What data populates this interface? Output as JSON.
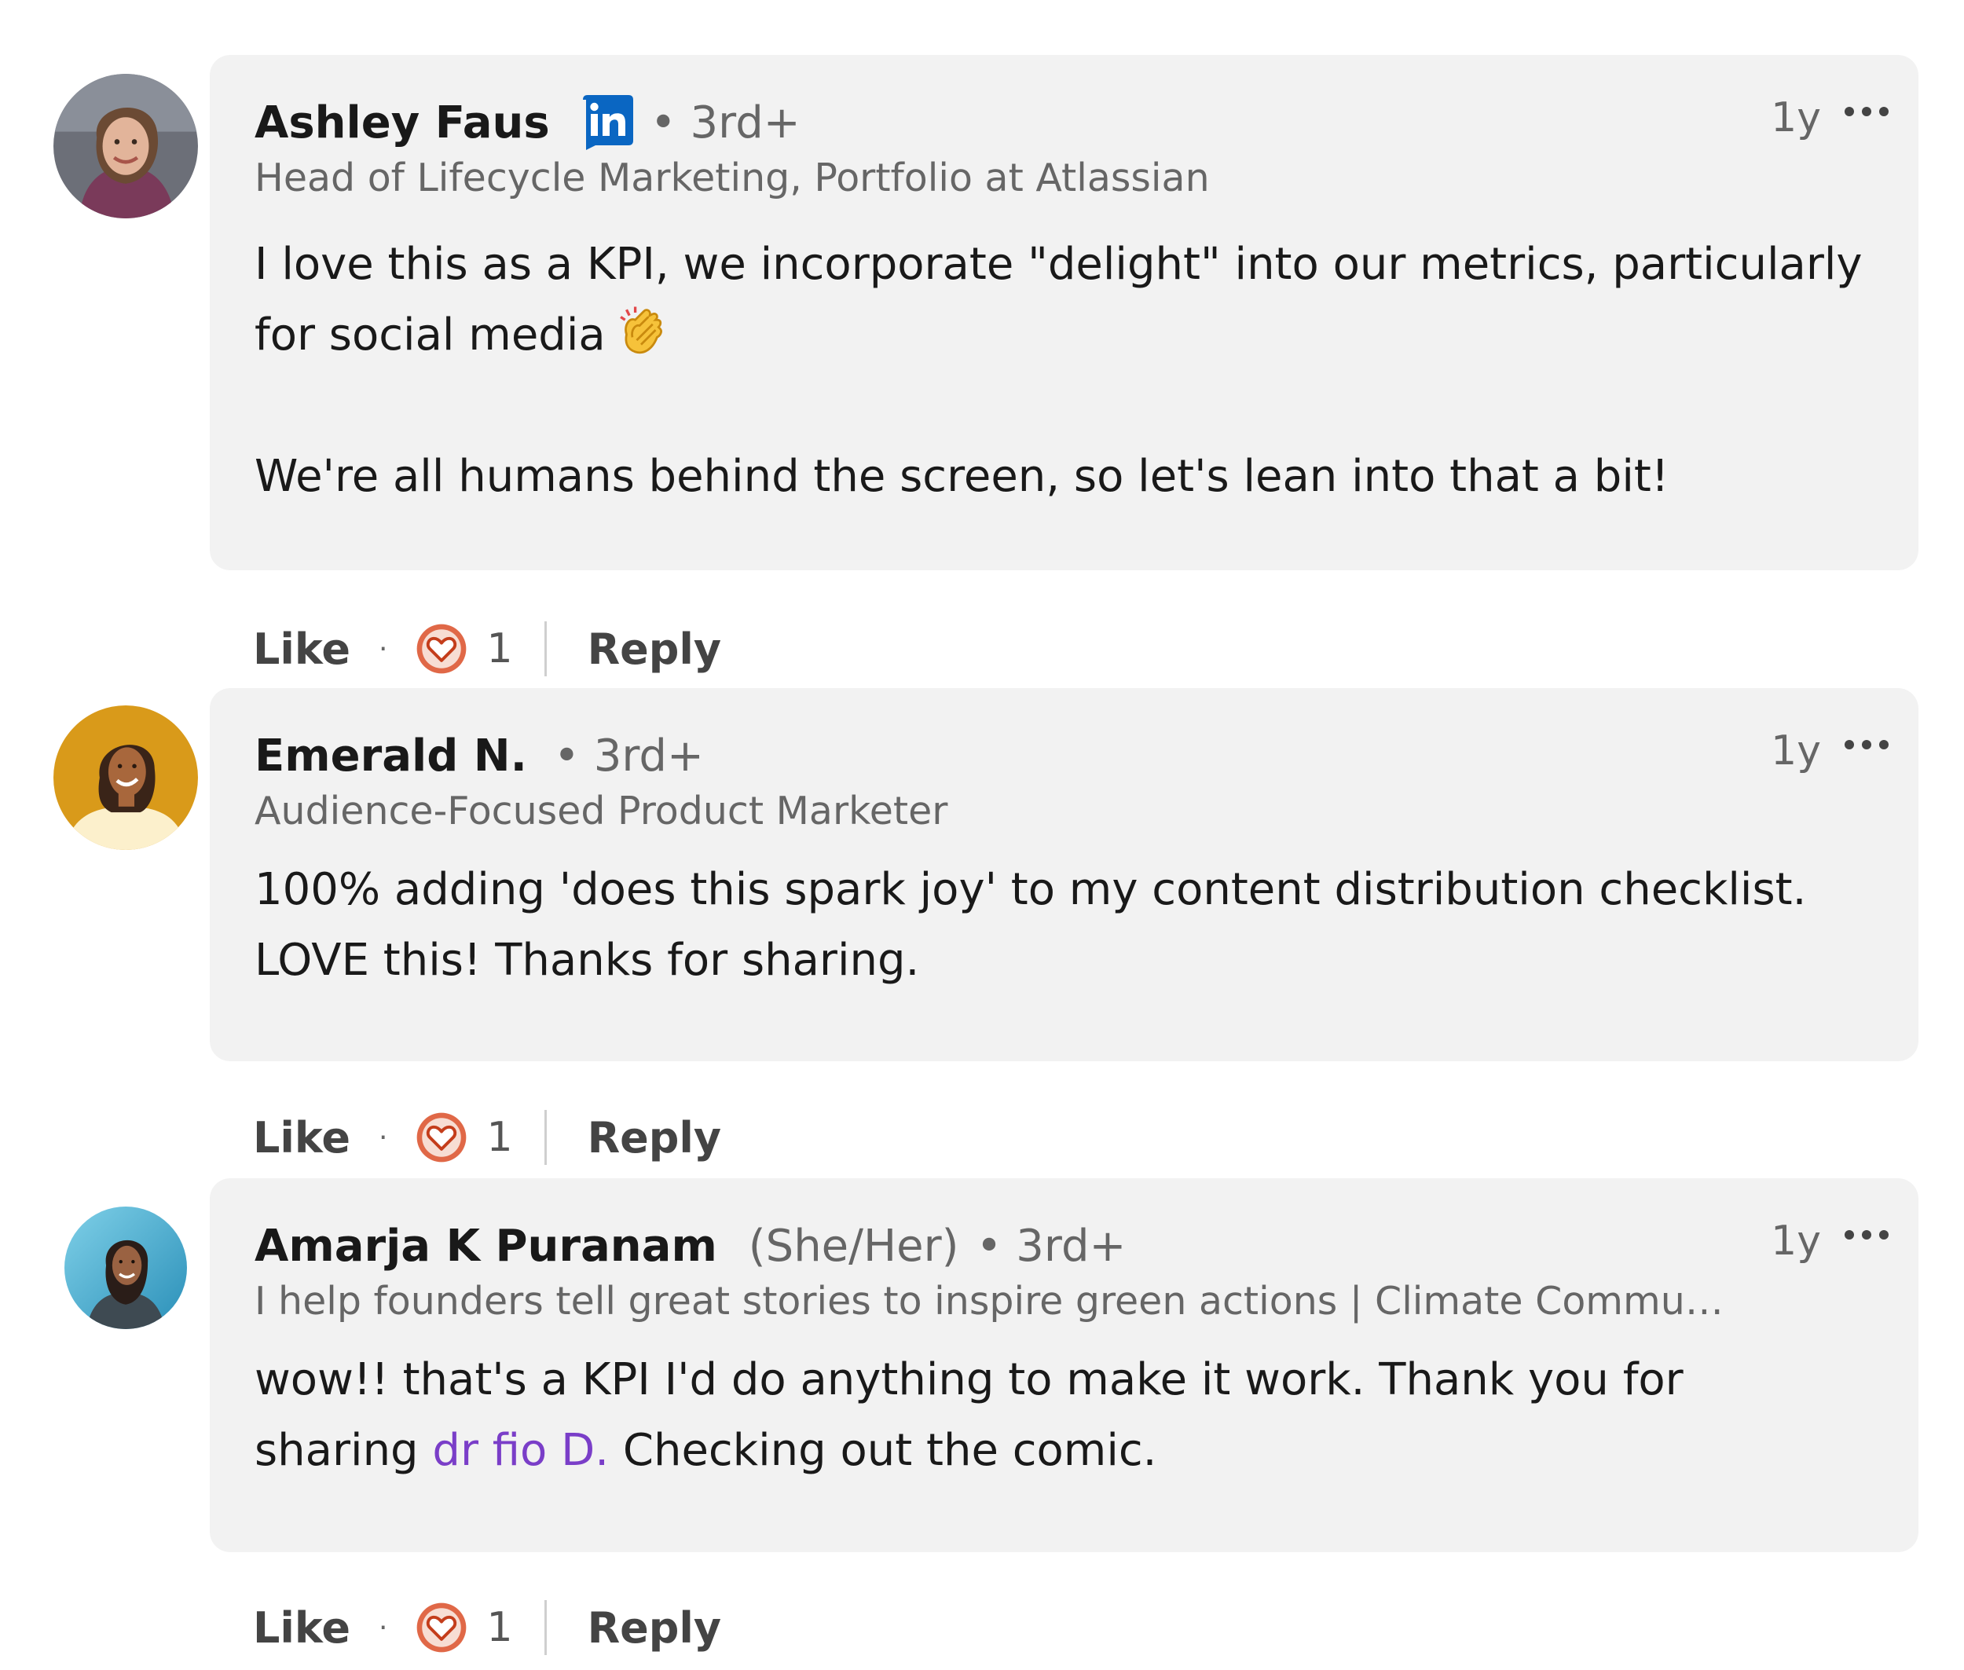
{
  "comments": [
    {
      "author": "Ashley Faus",
      "pronouns": "",
      "badge": "in",
      "degree": "• 3rd+",
      "time": "1y",
      "headline": "Head of Lifecycle Marketing, Portfolio at Atlassian",
      "body": [
        "I love this as a KPI, we incorporate \"delight\" into our metrics, particularly for social media",
        "We're all humans behind the screen, so let's lean into that a bit!"
      ],
      "emoji": "clapping-hands",
      "actions": {
        "like": "Like",
        "dot": "·",
        "count": "1",
        "reply": "Reply"
      }
    },
    {
      "author": "Emerald N.",
      "pronouns": "",
      "degree": "• 3rd+",
      "time": "1y",
      "headline": "Audience-Focused Product Marketer",
      "body": [
        "100% adding 'does this spark joy' to my content distribution checklist.",
        "LOVE this! Thanks for sharing."
      ],
      "actions": {
        "like": "Like",
        "dot": "·",
        "count": "1",
        "reply": "Reply"
      }
    },
    {
      "author": "Amarja K Puranam",
      "pronouns": "(She/Her)",
      "degree": "• 3rd+",
      "time": "1y",
      "headline": "I help founders tell great stories to inspire green actions | Climate Commu…",
      "body_line1": "wow!! that's a KPI I'd do anything to make it work. Thank you for",
      "body_line2_pre": "sharing ",
      "mention": "dr fio D.",
      "body_line2_post": " Checking out the comic.",
      "actions": {
        "like": "Like",
        "dot": "·",
        "count": "1",
        "reply": "Reply"
      }
    }
  ],
  "colors": {
    "bubble": "#f2f2f2",
    "muted": "#666666",
    "text": "#191919",
    "mention": "#7a3ec8",
    "linkedin": "#0a66c2",
    "love": "#e06847"
  }
}
